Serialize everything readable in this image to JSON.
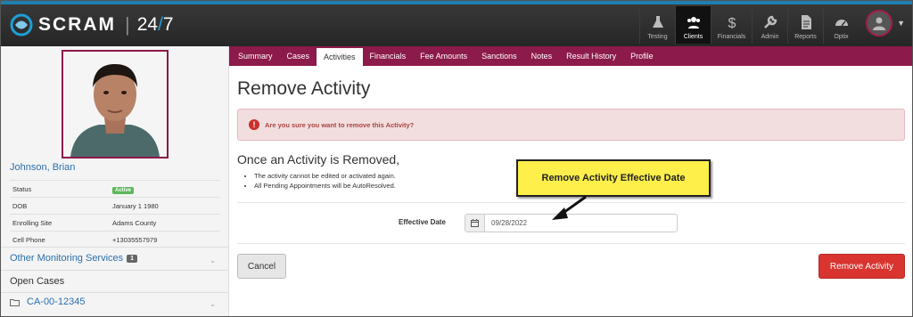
{
  "app": {
    "logo_text": "SCRAM",
    "logo_suffix": "24",
    "logo_slash": "/",
    "logo_suffix2": "7"
  },
  "nav": {
    "items": [
      {
        "label": "Testing",
        "icon": "flask-icon"
      },
      {
        "label": "Clients",
        "icon": "users-icon",
        "active": true
      },
      {
        "label": "Financials",
        "icon": "dollar-icon"
      },
      {
        "label": "Admin",
        "icon": "wrench-icon"
      },
      {
        "label": "Reports",
        "icon": "document-icon"
      },
      {
        "label": "Optix",
        "icon": "gauge-icon"
      }
    ]
  },
  "tabs": [
    "Summary",
    "Cases",
    "Activities",
    "Financials",
    "Fee Amounts",
    "Sanctions",
    "Notes",
    "Result History",
    "Profile"
  ],
  "active_tab": "Activities",
  "client": {
    "name": "Johnson, Brian",
    "rows": [
      {
        "label": "Status",
        "value": "Active"
      },
      {
        "label": "DOB",
        "value": "January 1 1980"
      },
      {
        "label": "Enrolling Site",
        "value": "Adams County"
      },
      {
        "label": "Cell Phone",
        "value": "+13035557979"
      }
    ]
  },
  "sidebar": {
    "other_monitoring_label": "Other Monitoring Services",
    "other_monitoring_count": "1",
    "open_cases_label": "Open Cases",
    "case_id": "CA-00-12345"
  },
  "main": {
    "title": "Remove Activity",
    "alert_text": "Are you sure you want to remove this Activity?",
    "subhead": "Once an Activity is Removed,",
    "bullets": [
      "The activity cannot be edited or activated again.",
      "All Pending Appointments will be AutoResolved."
    ],
    "effective_date_label": "Effective Date",
    "effective_date_value": "09/28/2022",
    "cancel_label": "Cancel",
    "remove_label": "Remove Activity"
  },
  "callout": {
    "text": "Remove Activity Effective Date"
  },
  "colors": {
    "brand_maroon": "#8c1a4a",
    "danger": "#d9342f",
    "link": "#2a6fae",
    "callout_yellow": "#ffef4a"
  }
}
